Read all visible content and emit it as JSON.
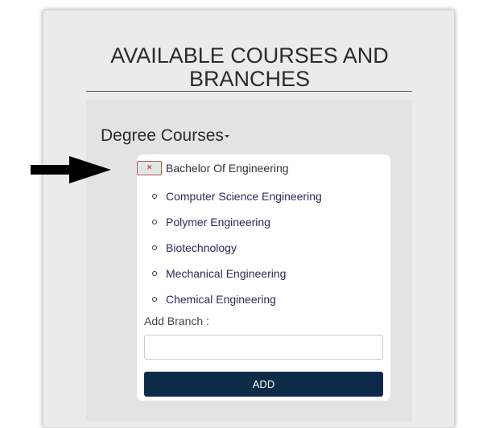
{
  "page": {
    "title": "AVAILABLE COURSES AND BRANCHES"
  },
  "section": {
    "title": "Degree Courses"
  },
  "degree": {
    "remove_label": "×",
    "name": "Bachelor Of Engineering"
  },
  "branches": [
    {
      "label": "Computer Science Engineering"
    },
    {
      "label": "Polymer Engineering"
    },
    {
      "label": "Biotechnology"
    },
    {
      "label": "Mechanical Engineering"
    },
    {
      "label": "Chemical Engineering"
    }
  ],
  "form": {
    "add_branch_label": "Add Branch :",
    "branch_value": "",
    "add_button_label": "ADD"
  },
  "icons": {
    "arrow": "right-arrow-icon",
    "remove": "close-icon",
    "caret": "caret-down-icon",
    "bullet": "circle-bullet-icon"
  },
  "colors": {
    "add_button": "#0d2b48",
    "remove_border": "#b35a5a",
    "remove_x": "#c0392b",
    "branch_text": "#2a2a5a"
  }
}
